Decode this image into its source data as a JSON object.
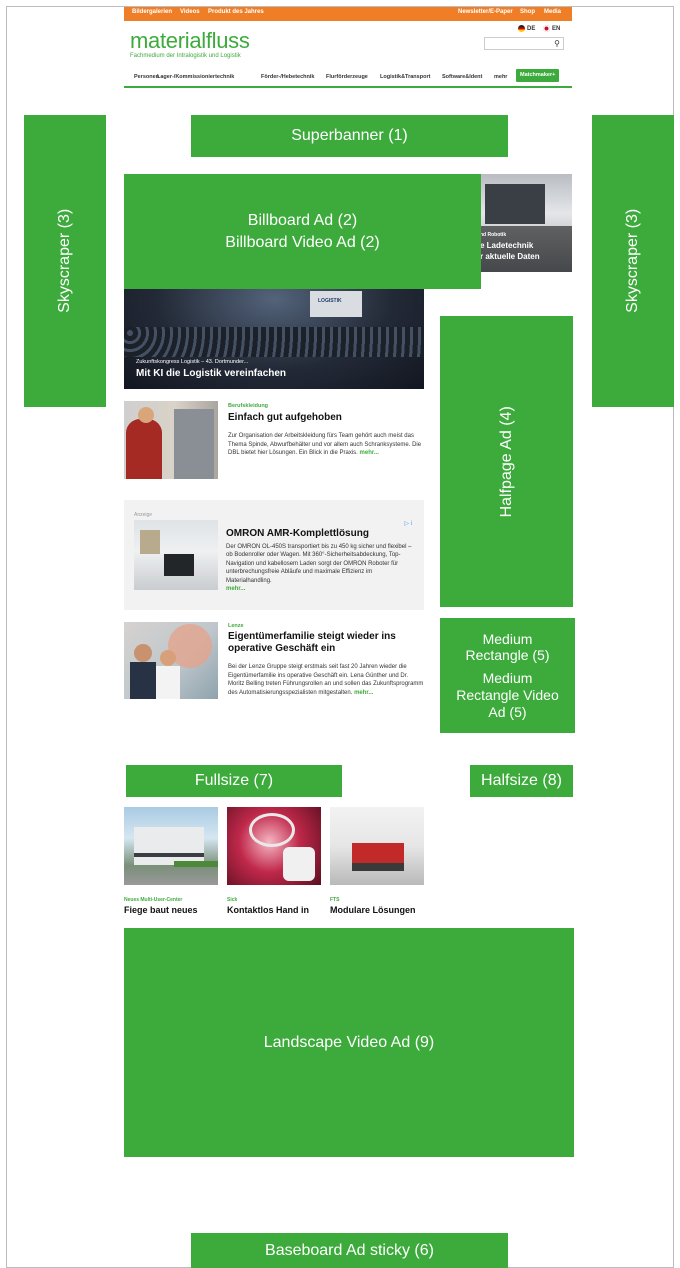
{
  "topbar": {
    "left_links": [
      "Bildergalerien",
      "Videos",
      "Produkt des Jahres"
    ],
    "right_links": [
      "Newsletter/E-Paper",
      "Shop",
      "Media"
    ]
  },
  "header": {
    "logo": "materialfluss",
    "tagline": "Fachmedium der Intralogistik und Logistik",
    "lang_de": "DE",
    "lang_en": "EN"
  },
  "nav": {
    "items": [
      "Personen",
      "Lager-/Kommissioniertechnik",
      "Förder-/Hebetechnik",
      "Flurförderzeuge",
      "Logistik&Transport",
      "Software&Ident",
      "mehr"
    ],
    "cta": "Matchmaker+"
  },
  "ads": {
    "superbanner": "Superbanner (1)",
    "billboard": "Billboard Ad (2)\nBillboard Video Ad (2)",
    "skyscraper_left": "Skyscraper (3)",
    "skyscraper_right": "Skyscraper (3)",
    "halfpage": "Halfpage Ad (4)",
    "medium_rect": "Medium\nRectangle (5)",
    "medium_rect_video": "Medium\nRectangle Video\nAd (5)",
    "fullsize": "Fullsize (7)",
    "halfsize": "Halfsize (8)",
    "landscape_video": "Landscape Video Ad (9)",
    "baseboard": "Baseboard Ad sticky (6)"
  },
  "peek": {
    "kicker": "nd Robotik",
    "line1": "e Ladetechnik",
    "line2": "r aktuelle Daten"
  },
  "hero": {
    "kicker": "Zukunftskongress Logistik – 43. Dortmunder...",
    "headline": "Mit KI die Logistik vereinfachen",
    "screen_text": "LOGISTIK"
  },
  "article1": {
    "kicker": "Berufskleidung",
    "headline": "Einfach gut aufgehoben",
    "text": "Zur Organisation der Arbeitskleidung fürs Team gehört auch meist das Thema Spinde, Abwurfbehälter und vor allem auch Schranksysteme. Die DBL bietet hier Lösungen. Ein Blick in die Praxis.",
    "more": "mehr..."
  },
  "sponsored": {
    "label": "Anzeige",
    "adchoices": "▷ i",
    "headline": "OMRON AMR-Komplettlösung",
    "text": "Der OMRON OL-450S transportiert bis zu 450 kg sicher und flexibel – ob Bodenroller oder Wagen. Mit 360°-Sicherheitsabdeckung, Top-Navigation und kabellosem Laden sorgt der OMRON Roboter für unterbrechungsfreie Abläufe und maximale Effizienz im Materialhandling.",
    "more": "mehr..."
  },
  "article2": {
    "kicker": "Lenze",
    "headline": "Eigentümerfamilie steigt wieder ins operative Geschäft ein",
    "text": "Bei der Lenze Gruppe steigt erstmals seit fast 20 Jahren wieder die Eigentümerfamilie ins operative Geschäft ein. Lena Günther und Dr. Moritz Belling treten Führungsrollen an und sollen das Zukunftsprogramm des Automatisierungsspezialisten mitgestalten.",
    "more": "mehr..."
  },
  "teasers": [
    {
      "kicker": "Neues Multi-User-Center",
      "headline": "Fiege baut neues"
    },
    {
      "kicker": "Sick",
      "headline": "Kontaktlos Hand in"
    },
    {
      "kicker": "FTS",
      "headline": "Modulare Lösungen"
    }
  ],
  "colors": {
    "brand_green": "#3dab3c",
    "topbar_orange": "#f07e26"
  }
}
